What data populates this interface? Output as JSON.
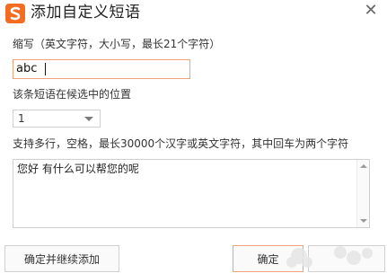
{
  "window": {
    "title": "添加自定义短语",
    "close_symbol": "✕"
  },
  "abbreviation": {
    "label": "缩写（英文字符，大小写，最长21个字符）",
    "value": "abc"
  },
  "position": {
    "label": "该条短语在候选中的位置",
    "selected": "1"
  },
  "phrase": {
    "label": "支持多行，空格，最长30000个汉字或英文字符，其中回车为两个字符",
    "value": "您好 有什么可以帮您的呢"
  },
  "buttons": {
    "confirm_continue": "确定并继续添加",
    "confirm": "确定",
    "extra": ""
  },
  "colors": {
    "logo": "#f26c21",
    "focus_border": "#f0a37a"
  },
  "icons": {
    "logo": "sogou-logo-icon",
    "close": "close-icon",
    "dropdown": "chevron-down-icon"
  }
}
